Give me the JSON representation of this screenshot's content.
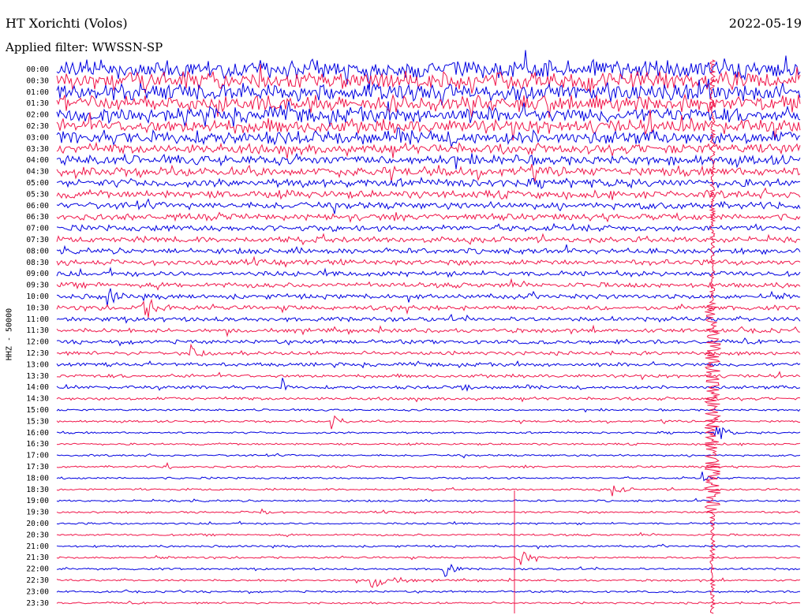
{
  "header": {
    "station": "HT Xorichti (Volos)",
    "date": "2022-05-19",
    "filter": "Applied filter: WWSSN-SP"
  },
  "chart_data": {
    "type": "line",
    "channel_label": "HHZ - 50000",
    "row_labels": [
      "00:00",
      "00:30",
      "01:00",
      "01:30",
      "02:00",
      "02:30",
      "03:00",
      "03:30",
      "04:00",
      "04:30",
      "05:00",
      "05:30",
      "06:00",
      "06:30",
      "07:00",
      "07:30",
      "08:00",
      "08:30",
      "09:00",
      "09:30",
      "10:00",
      "10:30",
      "11:00",
      "11:30",
      "12:00",
      "12:30",
      "13:00",
      "13:30",
      "14:00",
      "14:30",
      "15:00",
      "15:30",
      "16:00",
      "16:30",
      "17:00",
      "17:30",
      "18:00",
      "18:30",
      "19:00",
      "19:30",
      "20:00",
      "20:30",
      "21:00",
      "21:30",
      "22:00",
      "22:30",
      "23:00",
      "23:30"
    ],
    "colors": {
      "even": "#0000e0",
      "odd": "#f0164a"
    },
    "row_spacing": 14.4
  }
}
